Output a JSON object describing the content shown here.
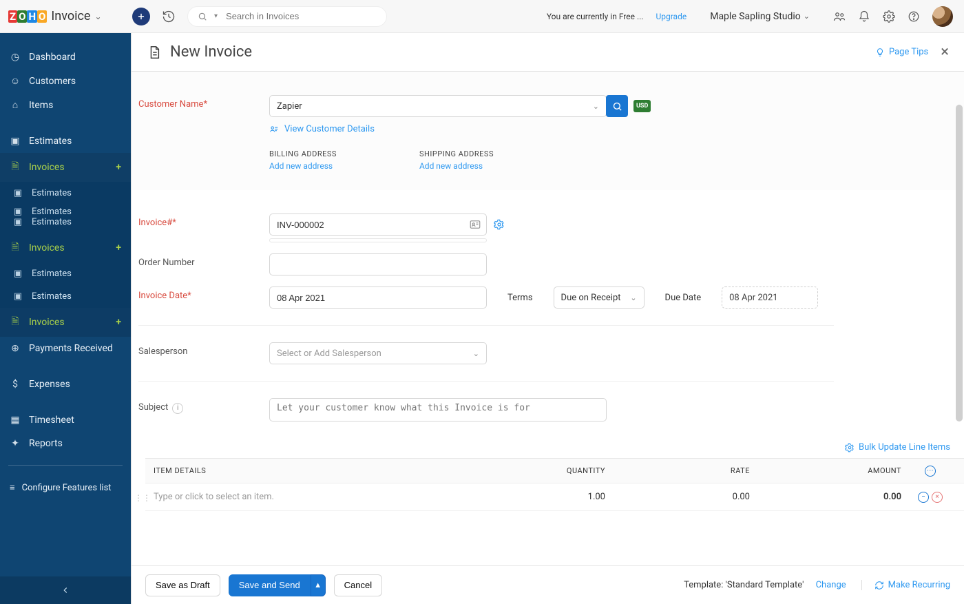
{
  "header": {
    "product": "Invoice",
    "search_placeholder": "Search in Invoices",
    "plan_notice": "You are currently in Free ...",
    "upgrade": "Upgrade",
    "org": "Maple Sapling Studio"
  },
  "sidebar": {
    "items": [
      {
        "label": "Dashboard"
      },
      {
        "label": "Customers"
      },
      {
        "label": "Items"
      },
      {
        "label": "Estimates"
      },
      {
        "label": "Invoices"
      },
      {
        "label": "Estimates"
      },
      {
        "label": "Estimates"
      },
      {
        "label": "Estimates"
      },
      {
        "label": "Invoices"
      },
      {
        "label": "Estimates"
      },
      {
        "label": "Estimates"
      },
      {
        "label": "Invoices"
      },
      {
        "label": "Payments Received"
      },
      {
        "label": "Expenses"
      },
      {
        "label": "Timesheet"
      },
      {
        "label": "Reports"
      }
    ],
    "configure": "Configure Features list"
  },
  "page": {
    "title": "New Invoice",
    "page_tips": "Page Tips",
    "close": "×",
    "customer_label": "Customer Name*",
    "customer_value": "Zapier",
    "currency": "USD",
    "view_customer": "View Customer Details",
    "billing_title": "BILLING ADDRESS",
    "shipping_title": "SHIPPING ADDRESS",
    "add_address": "Add new address",
    "invoice_no_label": "Invoice#*",
    "invoice_no": "INV-000002",
    "order_no_label": "Order Number",
    "order_no": "",
    "invoice_date_label": "Invoice Date*",
    "invoice_date": "08 Apr 2021",
    "terms_label": "Terms",
    "terms_value": "Due on Receipt",
    "due_date_label": "Due Date",
    "due_date": "08 Apr 2021",
    "salesperson_label": "Salesperson",
    "salesperson_placeholder": "Select or Add Salesperson",
    "subject_label": "Subject",
    "subject_placeholder": "Let your customer know what this Invoice is for",
    "bulk_link": "Bulk Update Line Items",
    "cols": {
      "item": "ITEM DETAILS",
      "qty": "QUANTITY",
      "rate": "RATE",
      "amount": "AMOUNT"
    },
    "row": {
      "item_placeholder": "Type or click to select an item.",
      "qty": "1.00",
      "rate": "0.00",
      "amount": "0.00"
    }
  },
  "footer": {
    "save_draft": "Save as Draft",
    "save_send": "Save and Send",
    "cancel": "Cancel",
    "template_label": "Template: ",
    "template_name": "'Standard Template'",
    "change": "Change",
    "make_recurring": "Make Recurring"
  }
}
